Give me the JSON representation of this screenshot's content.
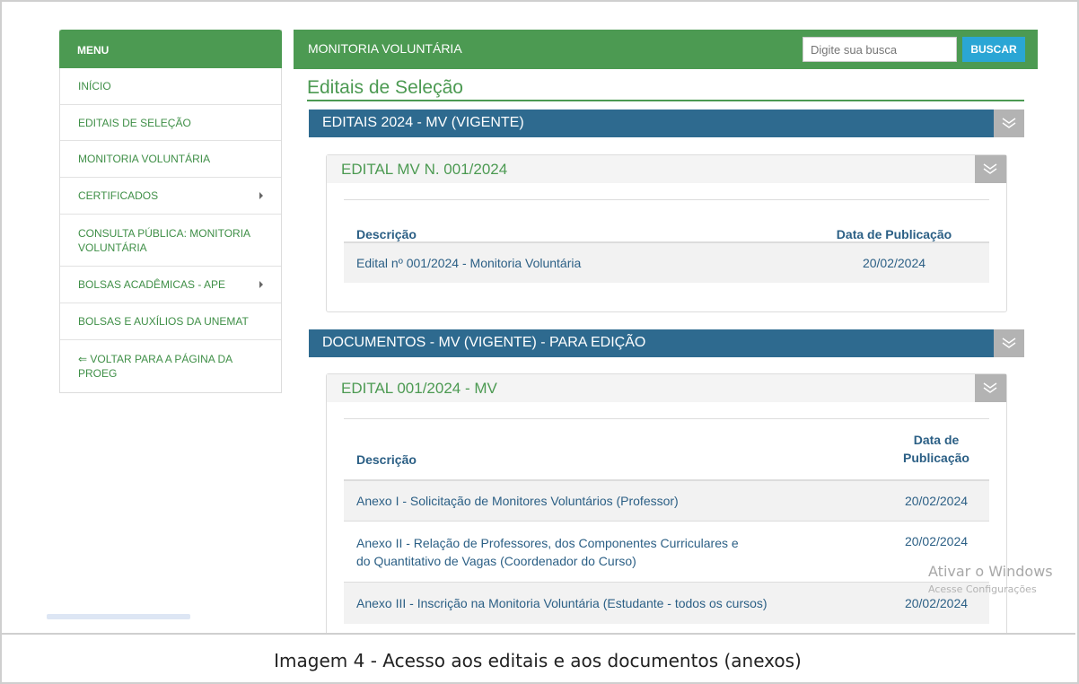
{
  "sidebar": {
    "header": "MENU",
    "items": [
      {
        "label": "INÍCIO",
        "has_caret": false
      },
      {
        "label": "EDITAIS DE SELEÇÃO",
        "has_caret": false
      },
      {
        "label": "MONITORIA VOLUNTÁRIA",
        "has_caret": false
      },
      {
        "label": "CERTIFICADOS",
        "has_caret": true
      },
      {
        "label": "CONSULTA PÚBLICA: MONITORIA VOLUNTÁRIA",
        "has_caret": false
      },
      {
        "label": "BOLSAS ACADÊMICAS - APE",
        "has_caret": true
      },
      {
        "label": "BOLSAS E AUXÍLIOS DA UNEMAT",
        "has_caret": false
      },
      {
        "label": "⇐ VOLTAR PARA A PÁGINA DA PROEG",
        "has_caret": false
      }
    ]
  },
  "topbar": {
    "title": "MONITORIA VOLUNTÁRIA",
    "search_placeholder": "Digite sua busca",
    "search_button": "BUSCAR"
  },
  "page_title": "Editais de Seleção",
  "sections": [
    {
      "title": "EDITAIS 2024 - MV (VIGENTE)",
      "panel": {
        "title": "EDITAL MV N. 001/2024",
        "columns": [
          "Descrição",
          "Data de Publicação"
        ],
        "rows": [
          {
            "description": "Edital nº 001/2024 - Monitoria Voluntária",
            "date": "20/02/2024"
          }
        ]
      }
    },
    {
      "title": "DOCUMENTOS - MV (VIGENTE) - PARA EDIÇÃO",
      "panel": {
        "title": "EDITAL 001/2024 - MV",
        "columns": [
          "Descrição",
          "Data de Publicação"
        ],
        "rows": [
          {
            "description": "Anexo I - Solicitação de Monitores Voluntários (Professor)",
            "date": "20/02/2024"
          },
          {
            "description": "Anexo II - Relação de Professores, dos Componentes Curriculares e do Quantitativo de Vagas (Coordenador do Curso)",
            "date": "20/02/2024"
          },
          {
            "description": "Anexo III - Inscrição na Monitoria Voluntária (Estudante - todos os cursos)",
            "date": "20/02/2024"
          }
        ]
      }
    }
  ],
  "watermark": {
    "line1": "Ativar o Windows",
    "line2": "Acesse Configurações"
  },
  "caption": "Imagem 4 - Acesso aos editais e aos documentos (anexos)"
}
